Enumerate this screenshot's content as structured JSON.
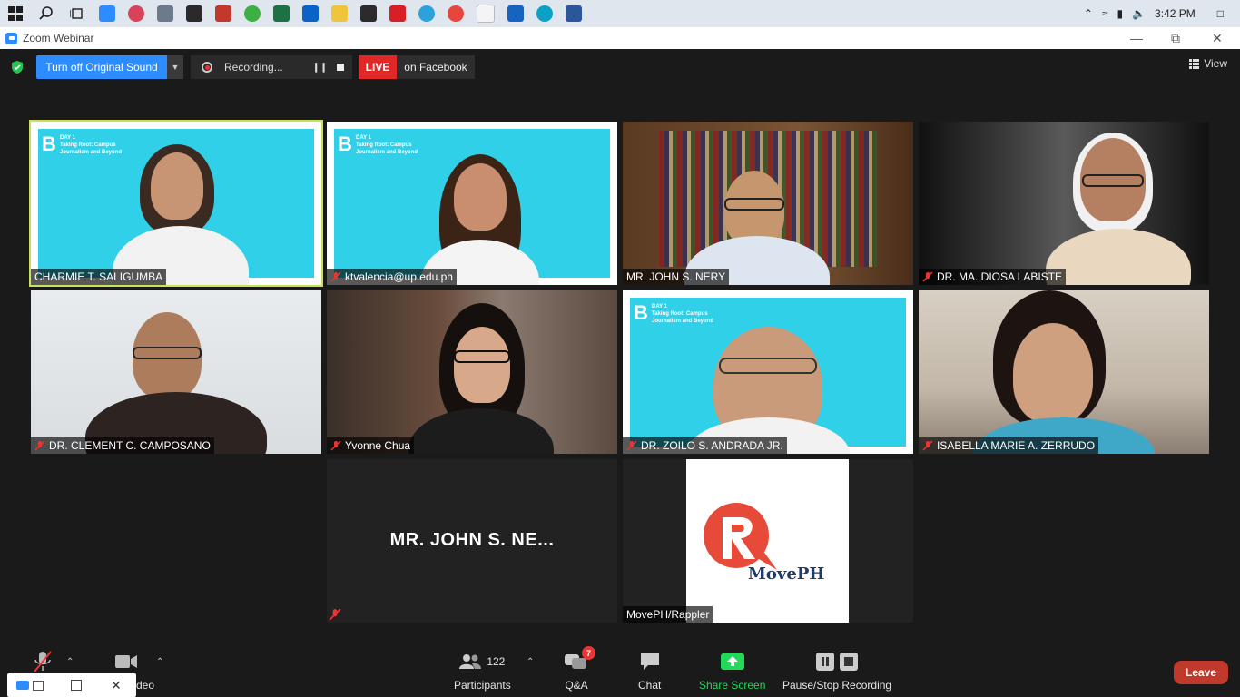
{
  "taskbar": {
    "clock": "3:42 PM"
  },
  "window": {
    "title": "Zoom Webinar"
  },
  "topbar": {
    "original_sound_label": "Turn off Original Sound",
    "recording_label": "Recording...",
    "live_label": "LIVE",
    "live_target": "on Facebook",
    "view_label": "View"
  },
  "tiles": [
    {
      "name": "CHARMIE T. SALIGUMBA",
      "slide_day": "DAY 1",
      "slide_title": "Taking Root: Campus Journalism and Beyond"
    },
    {
      "name": "ktvalencia@up.edu.ph",
      "slide_day": "DAY 1",
      "slide_title": "Taking Root: Campus Journalism and Beyond"
    },
    {
      "name": "MR. JOHN S. NERY"
    },
    {
      "name": "DR. MA. DIOSA LABISTE"
    },
    {
      "name": "DR. CLEMENT C. CAMPOSANO"
    },
    {
      "name": "Yvonne Chua"
    },
    {
      "name": "DR. ZOILO S. ANDRADA JR.",
      "slide_day": "DAY 1",
      "slide_title": "Taking Root: Campus Journalism and Beyond"
    },
    {
      "name": "ISABELLA MARIE A. ZERRUDO"
    },
    {
      "big_name": "MR. JOHN S. NE..."
    },
    {
      "name": "MovePH/Rappler",
      "logo_text": "MovePH"
    }
  ],
  "bottom": {
    "video_label": "deo",
    "participants_count": "122",
    "participants_label": "Participants",
    "qa_label": "Q&A",
    "qa_badge": "7",
    "chat_label": "Chat",
    "share_label": "Share Screen",
    "pause_stop_label": "Pause/Stop Recording",
    "leave_label": "Leave"
  },
  "colors": {
    "accent": "#2d8cff",
    "live": "#e02828",
    "share": "#23d959",
    "active_speaker": "#c9e25a",
    "leave": "#c0392b"
  }
}
